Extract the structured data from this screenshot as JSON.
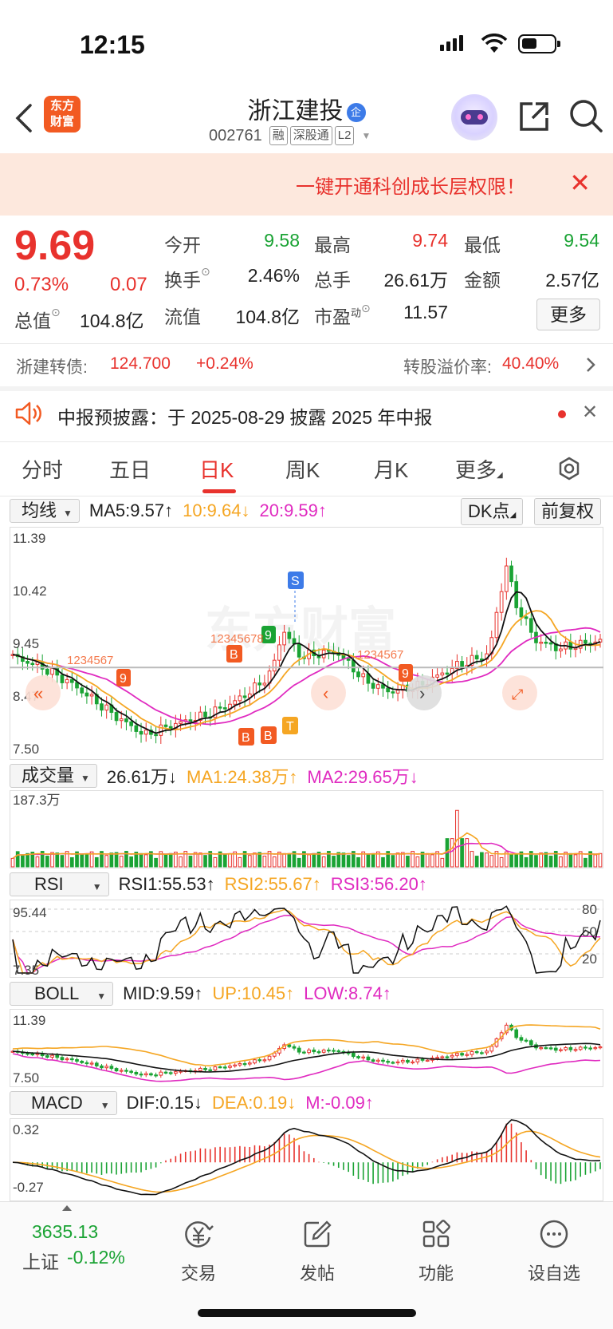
{
  "status_bar": {
    "time": "12:15"
  },
  "header": {
    "logo_line1": "东方",
    "logo_line2": "财富",
    "title": "浙江建投",
    "title_badge": "企",
    "code": "002761",
    "tags": [
      "融",
      "深股通",
      "L2"
    ]
  },
  "promo": {
    "text": "一键开通科创成长层权限！",
    "close": "✕"
  },
  "quote": {
    "price": "9.69",
    "pct": "0.73%",
    "change": "0.07",
    "total_cap_label": "总值",
    "total_cap_value": "104.8亿",
    "fields": [
      {
        "label": "今开",
        "value": "9.58",
        "color": "#1aa334"
      },
      {
        "label": "最高",
        "value": "9.74",
        "color": "#e8322d"
      },
      {
        "label": "最低",
        "value": "9.54",
        "color": "#1aa334"
      },
      {
        "label": "换手",
        "value": "2.46%",
        "color": "#222222"
      },
      {
        "label": "总手",
        "value": "26.61万",
        "color": "#222222"
      },
      {
        "label": "金额",
        "value": "2.57亿",
        "color": "#222222"
      },
      {
        "label": "流值",
        "value": "104.8亿",
        "color": "#222222"
      },
      {
        "label": "市盈",
        "value": "11.57",
        "color": "#222222"
      }
    ],
    "pe_sup": "动",
    "more_button": "更多"
  },
  "bond": {
    "label": "浙建转债:",
    "price": "124.700",
    "change": "+0.24%",
    "premium_label": "转股溢价率:",
    "premium_value": "40.40%"
  },
  "notice": {
    "text": "中报预披露：于 2025-08-29 披露 2025 年中报"
  },
  "tabs": [
    "分时",
    "五日",
    "日K",
    "周K",
    "月K",
    "更多"
  ],
  "active_tab": "日K",
  "ma_row": {
    "selector": "均线",
    "ma5": "MA5:9.57↑",
    "ma10": "10:9.64↓",
    "ma20": "20:9.59↑",
    "dk_button": "DK点",
    "fq_button": "前复权"
  },
  "kline_axis": [
    "11.39",
    "10.42",
    "9.45",
    "8.47",
    "7.50"
  ],
  "watermark": "东方财富",
  "vol_row": {
    "selector": "成交量",
    "vol": "26.61万↓",
    "ma1": "MA1:24.38万↑",
    "ma2": "MA2:29.65万↓",
    "max_label": "187.3万"
  },
  "rsi_row": {
    "selector": "RSI",
    "rsi1": "RSI1:55.53↑",
    "rsi2": "RSI2:55.67↑",
    "rsi3": "RSI3:56.20↑",
    "top": "95.44",
    "bottom": "7.35",
    "levels": [
      "80",
      "50",
      "20"
    ]
  },
  "boll_row": {
    "selector": "BOLL",
    "mid": "MID:9.59↑",
    "up": "UP:10.45↑",
    "low": "LOW:8.74↑",
    "top": "11.39",
    "bottom": "7.50"
  },
  "macd_row": {
    "selector": "MACD",
    "dif": "DIF:0.15↓",
    "dea": "DEA:0.19↓",
    "m": "M:-0.09↑",
    "top": "0.32",
    "bottom": "-0.27"
  },
  "chart_markers": {
    "s_label": "S",
    "t_label": "T",
    "b_label": "B",
    "nine_label": "9",
    "seq_left": "1234567",
    "seq_mid": "12345678",
    "seq_right": "1234567"
  },
  "bottom_bar": {
    "index_value": "3635.13",
    "index_name": "上证",
    "index_change": "-0.12%",
    "items": [
      "交易",
      "发帖",
      "功能",
      "设自选"
    ]
  }
}
